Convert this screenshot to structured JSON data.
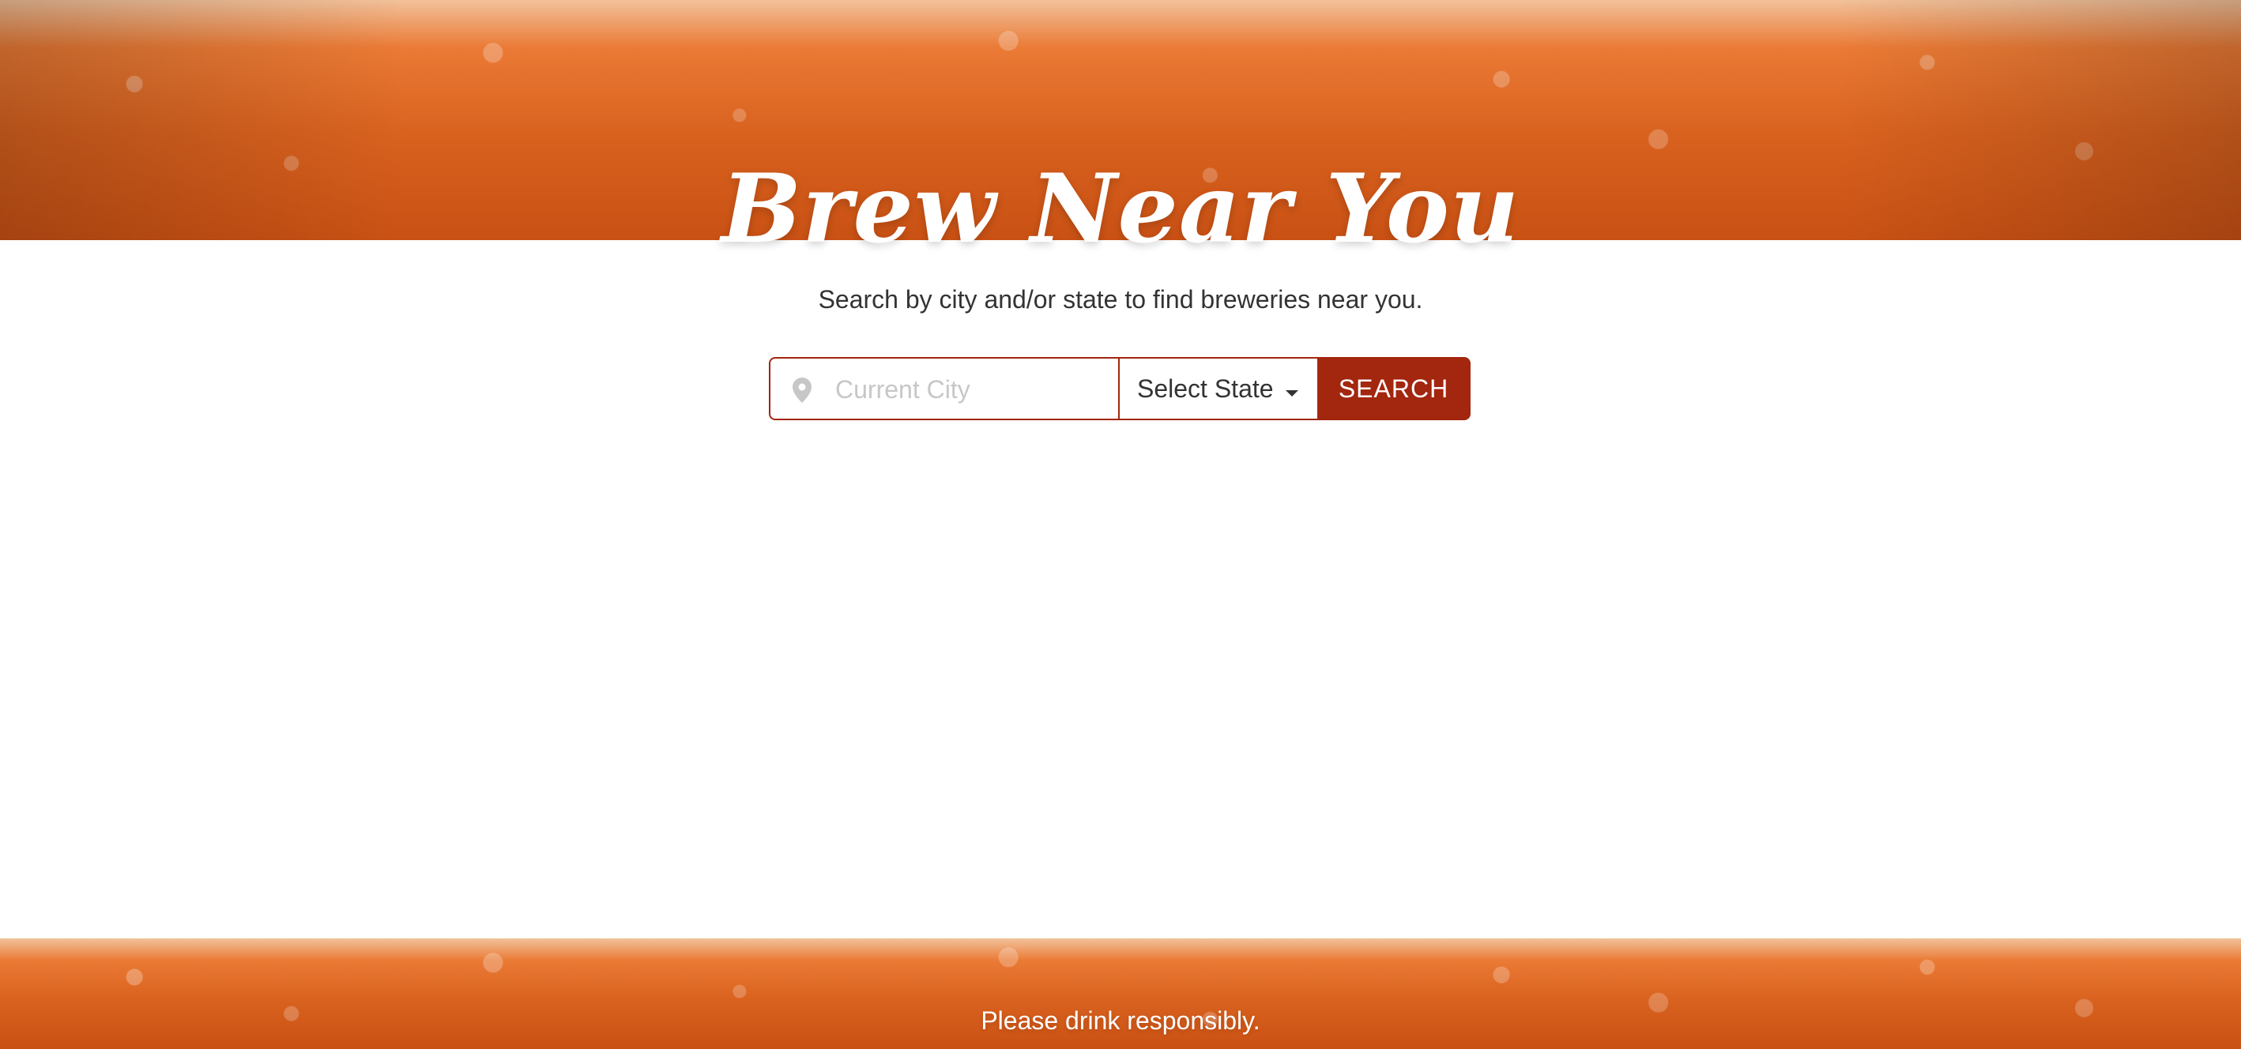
{
  "header": {
    "title": "Brew Near You"
  },
  "main": {
    "subtitle": "Search by city and/or state to find breweries near you.",
    "search": {
      "city_placeholder": "Current City",
      "city_value": "",
      "state_selected": "Select State",
      "button_label": "SEARCH",
      "icons": {
        "location": "map-pin-icon",
        "dropdown": "caret-down-icon"
      }
    }
  },
  "footer": {
    "text": "Please drink responsibly."
  },
  "colors": {
    "accent": "#A3260F",
    "text_dark": "#333333",
    "placeholder": "#C7C7C7",
    "white": "#FFFFFF",
    "beer_orange": "#D9621F"
  }
}
